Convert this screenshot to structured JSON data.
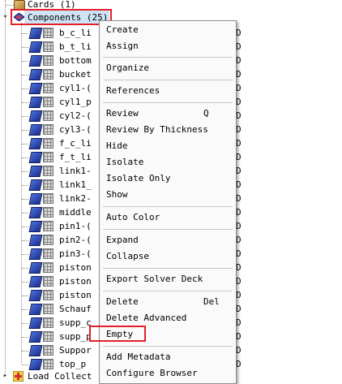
{
  "tree": {
    "cards_label": "Cards (1)",
    "components_label": "Components (25)",
    "load_collectors_label": "Load Collect",
    "children": [
      "b_c_li",
      "b_t_li",
      "bottom",
      "bucket",
      "cyl1-(",
      "cyl1_p",
      "cyl2-(",
      "cyl3-(",
      "f_c_li",
      "f_t_li",
      "link1-",
      "link1_",
      "link2-",
      "middle",
      "pin1-(",
      "pin2-(",
      "pin3-(",
      "piston",
      "piston",
      "piston",
      "Schauf",
      "supp_c",
      "supp_p",
      "Suppor",
      "top_p"
    ],
    "tail_char": "D"
  },
  "menu": {
    "items": [
      {
        "label": "Create",
        "shortcut": ""
      },
      {
        "label": "Assign",
        "shortcut": ""
      },
      {
        "label": "Organize",
        "shortcut": ""
      },
      {
        "label": "References",
        "shortcut": ""
      },
      {
        "label": "Review",
        "shortcut": "Q"
      },
      {
        "label": "Review By Thickness",
        "shortcut": ""
      },
      {
        "label": "Hide",
        "shortcut": ""
      },
      {
        "label": "Isolate",
        "shortcut": ""
      },
      {
        "label": "Isolate Only",
        "shortcut": ""
      },
      {
        "label": "Show",
        "shortcut": ""
      },
      {
        "label": "Auto Color",
        "shortcut": ""
      },
      {
        "label": "Expand",
        "shortcut": ""
      },
      {
        "label": "Collapse",
        "shortcut": ""
      },
      {
        "label": "Export Solver Deck",
        "shortcut": ""
      },
      {
        "label": "Delete",
        "shortcut": "Del"
      },
      {
        "label": "Delete Advanced",
        "shortcut": ""
      },
      {
        "label": "Empty",
        "shortcut": ""
      },
      {
        "label": "Add Metadata",
        "shortcut": ""
      },
      {
        "label": "Configure Browser",
        "shortcut": ""
      }
    ]
  },
  "colors": {
    "highlight_box": "#e3202a",
    "selection_bg": "#cfe3f7"
  }
}
